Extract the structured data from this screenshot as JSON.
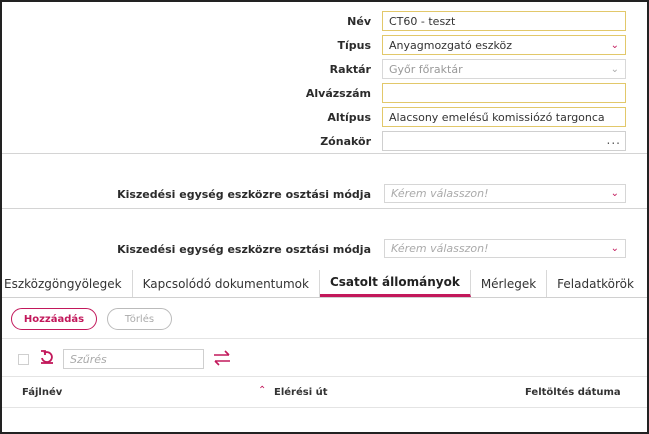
{
  "form": {
    "nev": {
      "label": "Név",
      "value": "CT60 - teszt"
    },
    "tipus": {
      "label": "Típus",
      "value": "Anyagmozgató eszköz"
    },
    "raktar": {
      "label": "Raktár",
      "value": "Győr főraktár"
    },
    "alvazszam": {
      "label": "Alvázszám",
      "value": ""
    },
    "altipus": {
      "label": "Altípus",
      "value": "Alacsony emelésű komissiózó targonca"
    },
    "zonakor": {
      "label": "Zónakör",
      "value": "",
      "more": "..."
    }
  },
  "sections": [
    {
      "label": "Kiszedési egység eszközre osztási módja",
      "placeholder": "Kérem válasszon!"
    },
    {
      "label": "Kiszedési egység eszközre osztási módja",
      "placeholder": "Kérem válasszon!"
    }
  ],
  "tabs": [
    {
      "label": "Eszközgöngyölegek"
    },
    {
      "label": "Kapcsolódó dokumentumok"
    },
    {
      "label": "Csatolt állományok"
    },
    {
      "label": "Mérlegek"
    },
    {
      "label": "Feladatkörök"
    }
  ],
  "toolbar": {
    "add_label": "Hozzáadás",
    "delete_label": "Törlés"
  },
  "filter": {
    "placeholder": "Szűrés"
  },
  "table": {
    "columns": [
      "Fájlnév",
      "Elérési út",
      "Feltöltés dátuma"
    ]
  },
  "colors": {
    "accent": "#c2185b",
    "required_border": "#e2c86a"
  },
  "icons": {
    "dropdown": "chevron-down-icon",
    "refresh": "refresh-icon",
    "swap": "swap-icon",
    "sort": "sort-asc-icon"
  }
}
